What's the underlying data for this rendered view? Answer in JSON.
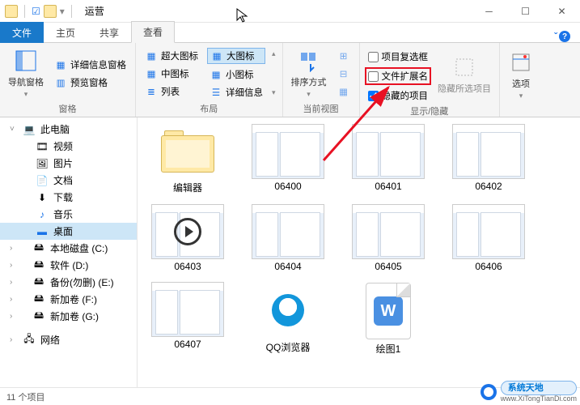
{
  "window": {
    "title": "运营"
  },
  "tabs": {
    "file": "文件",
    "home": "主页",
    "share": "共享",
    "view": "查看"
  },
  "ribbon": {
    "panes_group": "窗格",
    "nav_pane": "导航窗格",
    "preview_pane": "预览窗格",
    "details_pane": "详细信息窗格",
    "layout_group": "布局",
    "xl_icons": "超大图标",
    "l_icons": "大图标",
    "m_icons": "中图标",
    "s_icons": "小图标",
    "list": "列表",
    "details": "详细信息",
    "curview_group": "当前视图",
    "sort": "排序方式",
    "showhide_group": "显示/隐藏",
    "item_check": "项目复选框",
    "file_ext": "文件扩展名",
    "hidden_items": "隐藏的项目",
    "hide_selected": "隐藏所选项目",
    "options": "选项"
  },
  "nav": {
    "this_pc": "此电脑",
    "videos": "视频",
    "pictures": "图片",
    "documents": "文档",
    "downloads": "下载",
    "music": "音乐",
    "desktop": "桌面",
    "c_drive": "本地磁盘 (C:)",
    "d_drive": "软件 (D:)",
    "e_drive": "备份(勿删) (E:)",
    "f_drive": "新加卷 (F:)",
    "g_drive": "新加卷 (G:)",
    "network": "网络"
  },
  "files": {
    "f1": "编辑器",
    "f2": "06400",
    "f3": "06401",
    "f4": "06402",
    "f5": "06403",
    "f6": "06404",
    "f7": "06405",
    "f8": "06406",
    "f9": "06407",
    "f10": "QQ浏览器",
    "f11": "绘图1"
  },
  "status": {
    "count": "11 个项目"
  },
  "watermark": {
    "brand": "系统天地",
    "url": "www.XiTongTianDi.com"
  }
}
